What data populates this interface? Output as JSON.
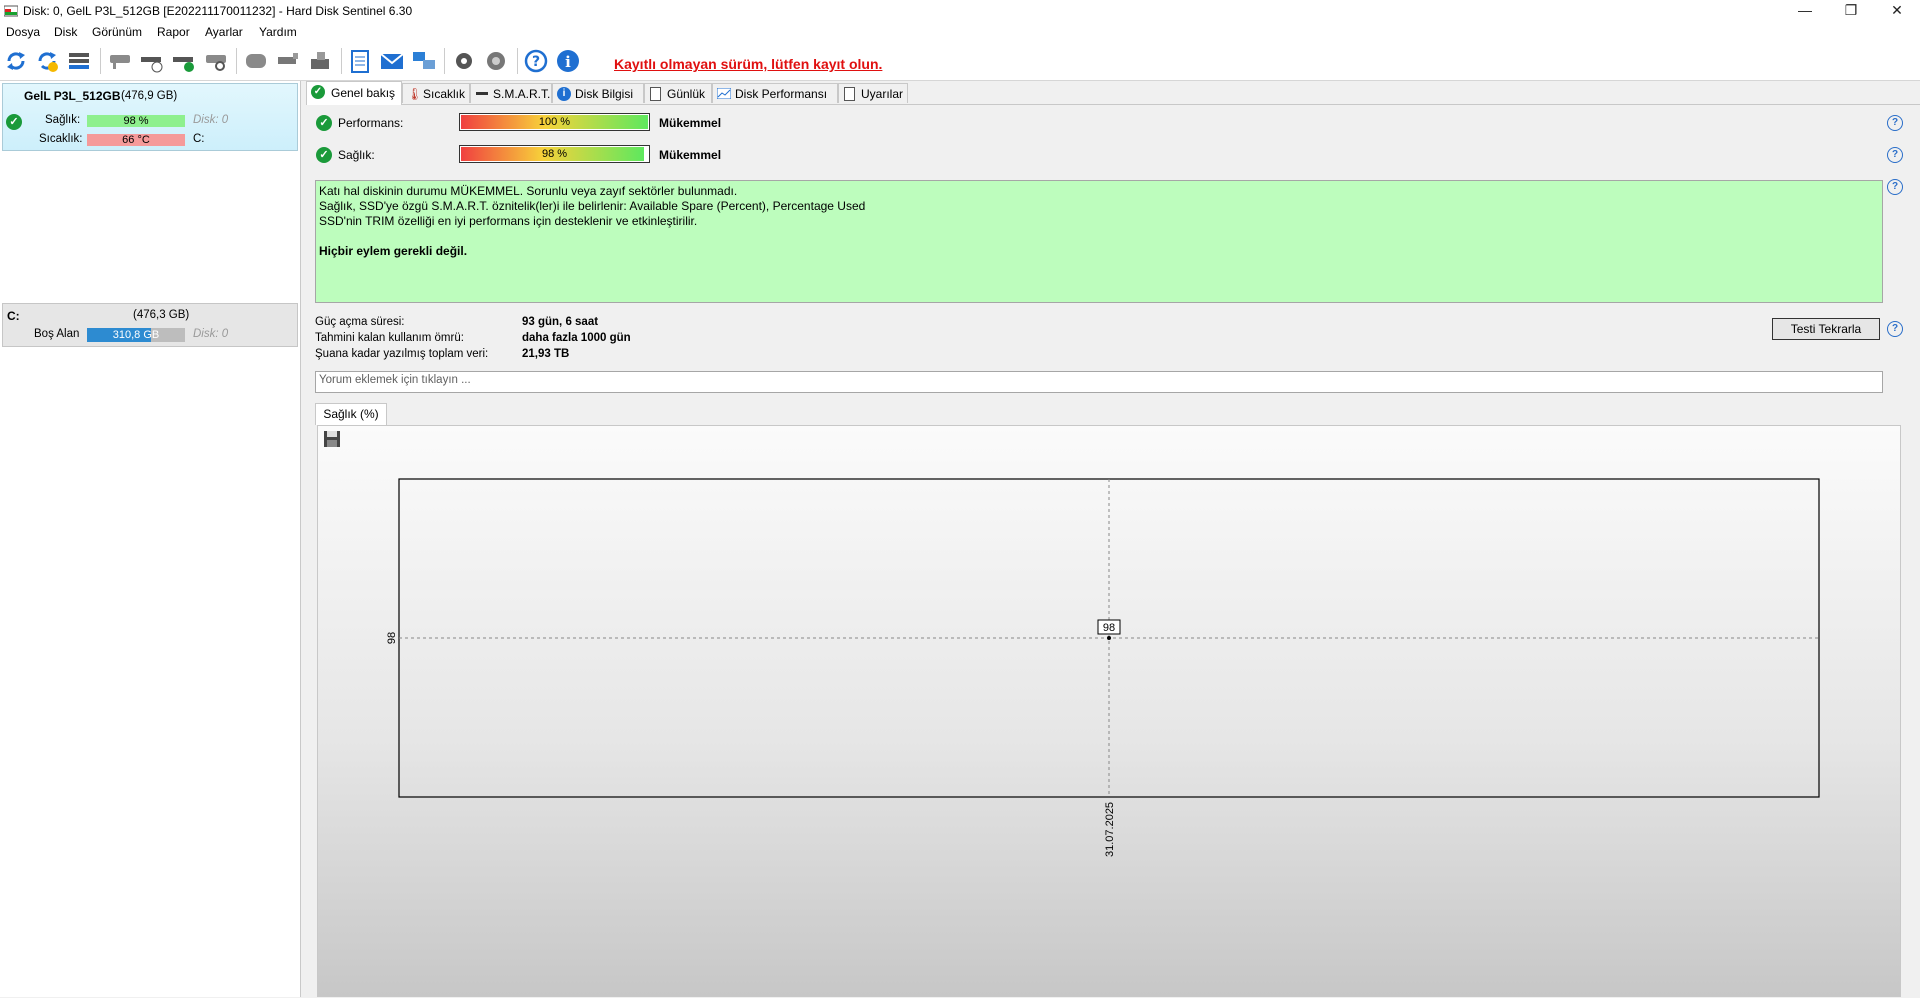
{
  "window": {
    "title": "Disk: 0, GelL P3L_512GB [E202211170011232]  -  Hard Disk Sentinel 6.30",
    "controls": [
      "—",
      "❐",
      "✕"
    ]
  },
  "menu": {
    "items": [
      "Dosya",
      "Disk",
      "Görünüm",
      "Rapor",
      "Ayarlar",
      "Yardım"
    ]
  },
  "toolbar": {
    "icons": [
      "refresh-icon",
      "refresh-all-icon",
      "disk-list-icon",
      "disk-gray-icon",
      "disk-clock-icon",
      "disk-check-icon",
      "disk-search-icon",
      "drive-icon",
      "tools-icon",
      "hardware-icon",
      "report-icon",
      "email-icon",
      "network-icon",
      "settings-icon",
      "alert-sound-icon",
      "help-icon",
      "info-icon"
    ],
    "register_text": "Kayıtlı olmayan sürüm, lütfen kayıt olun."
  },
  "disk_card": {
    "name": "GelL P3L_512GB",
    "size": "(476,9 GB)",
    "health_label": "Sağlık:",
    "health_value": "98 %",
    "health_disk": "Disk: 0",
    "temp_label": "Sıcaklık:",
    "temp_value": "66 °C",
    "temp_drive": "C:"
  },
  "volume_card": {
    "letter": "C:",
    "size": "(476,3 GB)",
    "free_label": "Boş Alan",
    "free_value": "310,8 GB",
    "free_disk": "Disk: 0",
    "free_fraction": 0.652
  },
  "tabs": [
    "Genel bakış",
    "Sıcaklık",
    "S.M.A.R.T.",
    "Disk Bilgisi",
    "Günlük",
    "Disk Performansı",
    "Uyarılar"
  ],
  "overview": {
    "performance_label": "Performans:",
    "performance_value": "100 %",
    "performance_fraction": 1.0,
    "performance_rating": "Mükemmel",
    "health_label": "Sağlık:",
    "health_value": "98 %",
    "health_fraction": 0.98,
    "health_rating": "Mükemmel",
    "summary_lines": [
      "Katı hal diskinin durumu MÜKEMMEL. Sorunlu veya zayıf sektörler bulunmadı.",
      "Sağlık, SSD'ye özgü S.M.A.R.T. öznitelik(ler)i ile belirlenir:  Available Spare (Percent), Percentage Used",
      "SSD'nin TRIM özelliği en iyi performans için desteklenir ve etkinleştirilir."
    ],
    "summary_action": "Hiçbir eylem gerekli değil.",
    "power_on_label": "Güç açma süresi:",
    "power_on_value": "93 gün, 6 saat",
    "lifetime_label": "Tahmini kalan kullanım ömrü:",
    "lifetime_value": "daha fazla 1000 gün",
    "written_label": "Şuana kadar yazılmış toplam veri:",
    "written_value": "21,93 TB",
    "retest_button": "Testi Tekrarla",
    "comment_placeholder": "Yorum eklemek için tıklayın ..."
  },
  "chart_tab": "Sağlık (%)",
  "chart_data": {
    "type": "line",
    "title": "",
    "xlabel": "",
    "ylabel": "",
    "x": [
      "31.07.2025"
    ],
    "series": [
      {
        "values": [
          98
        ]
      }
    ],
    "point_labels": [
      "98"
    ],
    "y_tick_labels": [
      "98"
    ],
    "grid": true
  },
  "colors": {
    "accent_red": "#e01010",
    "summary_bg": "#bdfdbd",
    "health_bar": "#8ef08e",
    "temp_bar": "#f59a9a",
    "free_bar": "#2d8bd1"
  }
}
